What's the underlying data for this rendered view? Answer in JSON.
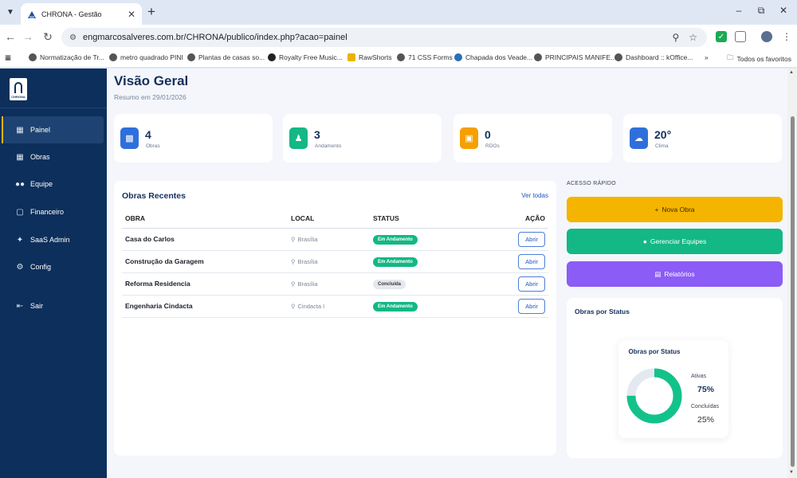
{
  "browser": {
    "tab_title": "CHRONA - Gestão",
    "url": "engmarcosalveres.com.br/CHRONA/publico/index.php?acao=painel",
    "bookmarks": [
      "Normatização de Tr...",
      "metro quadrado PINI",
      "Plantas de casas so...",
      "Royalty Free Music...",
      "RawShorts",
      "71 CSS Forms",
      "Chapada dos Veade...",
      "PRINCIPAIS MANIFE...",
      "Dashboard :: kOffice..."
    ],
    "all_bookmarks": "Todos os favoritos"
  },
  "sidebar": {
    "logo_text": "CHRONA",
    "items": [
      {
        "label": "Painel",
        "icon": "grid-icon"
      },
      {
        "label": "Obras",
        "icon": "building-icon"
      },
      {
        "label": "Equipe",
        "icon": "users-icon"
      },
      {
        "label": "Financeiro",
        "icon": "wallet-icon"
      },
      {
        "label": "SaaS Admin",
        "icon": "sparkle-icon"
      },
      {
        "label": "Config",
        "icon": "gear-icon"
      },
      {
        "label": "Sair",
        "icon": "logout-icon"
      }
    ]
  },
  "header": {
    "title": "Visão Geral",
    "subtitle": "Resumo em 29/01/2026"
  },
  "stats": [
    {
      "value": "4",
      "label": "Obras",
      "color": "#2f6fdc",
      "icon": "chart-icon"
    },
    {
      "value": "3",
      "label": "Andamento",
      "color": "#13b884",
      "icon": "chess-pawn-icon"
    },
    {
      "value": "0",
      "label": "RDOs",
      "color": "#f5a000",
      "icon": "clipboard-icon"
    },
    {
      "value": "20°",
      "label": "Clima",
      "color": "#2f6fdc",
      "icon": "cloud-sun-icon"
    }
  ],
  "recent": {
    "title": "Obras Recentes",
    "view_all": "Ver todas",
    "columns": [
      "OBRA",
      "LOCAL",
      "STATUS",
      "AÇÃO"
    ],
    "rows": [
      {
        "name": "Casa do Carlos",
        "location": "Brasília",
        "status": "Em Andamento",
        "action": "Abrir"
      },
      {
        "name": "Construção da Garagem",
        "location": "Brasília",
        "status": "Em Andamento",
        "action": "Abrir"
      },
      {
        "name": "Reforma Residencia",
        "location": "Brasília",
        "status": "Concluída",
        "action": "Abrir"
      },
      {
        "name": "Engenharia Cindacta",
        "location": "Cindacta I",
        "status": "Em Andamento",
        "action": "Abrir"
      }
    ]
  },
  "quick_access": {
    "title": "ACESSO RÁPIDO",
    "buttons": [
      {
        "label": "Nova Obra",
        "icon": "plus-icon",
        "color": "#f5b400",
        "text_color": "#3a2c00"
      },
      {
        "label": "Gerenciar Equipes",
        "icon": "users-icon",
        "color": "#13b884",
        "text_color": "#ffffff"
      },
      {
        "label": "Relatórios",
        "icon": "file-icon",
        "color": "#8b5cf6",
        "text_color": "#ffffff"
      }
    ]
  },
  "status_card": {
    "title": "Obras por Status"
  },
  "chart_data": {
    "type": "pie",
    "title": "Obras por Status",
    "categories": [
      "Ativas",
      "Concluídas"
    ],
    "values": [
      75,
      25
    ],
    "value_labels": [
      "75%",
      "25%"
    ],
    "colors": [
      "#13c28a",
      "#e3e8f1"
    ],
    "legend": "right"
  }
}
